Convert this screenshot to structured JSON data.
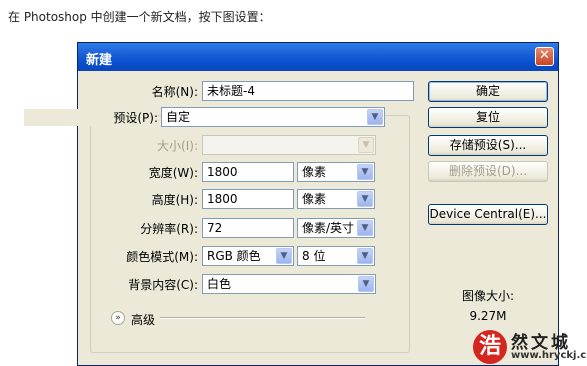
{
  "intro": "在 Photoshop 中创建一个新文档，按下图设置：",
  "dialog": {
    "title": "新建",
    "close_glyph": "✕",
    "fields": {
      "name": {
        "label": "名称(N):",
        "value": "未标题-4"
      },
      "preset": {
        "label": "预设(P):",
        "value": "自定"
      },
      "size": {
        "label": "大小(I):",
        "value": ""
      },
      "width": {
        "label": "宽度(W):",
        "value": "1800",
        "unit": "像素"
      },
      "height": {
        "label": "高度(H):",
        "value": "1800",
        "unit": "像素"
      },
      "resolution": {
        "label": "分辨率(R):",
        "value": "72",
        "unit": "像素/英寸"
      },
      "color_mode": {
        "label": "颜色模式(M):",
        "value": "RGB 颜色",
        "depth": "8 位"
      },
      "background": {
        "label": "背景内容(C):",
        "value": "白色"
      }
    },
    "advanced_label": "高级",
    "buttons": {
      "ok": "确定",
      "reset": "复位",
      "save_preset": "存储预设(S)...",
      "delete_preset": "删除预设(D)...",
      "device_central": "Device Central(E)..."
    },
    "image_size_label": "图像大小:",
    "image_size_value": "9.27M"
  },
  "watermark": {
    "mark": "浩",
    "name": "然文城",
    "url": "www.hryckj.cn"
  },
  "colors": {
    "titlebar": "#0a4fcf",
    "dialog_bg": "#ece9d8",
    "input_border": "#7f9db9"
  }
}
